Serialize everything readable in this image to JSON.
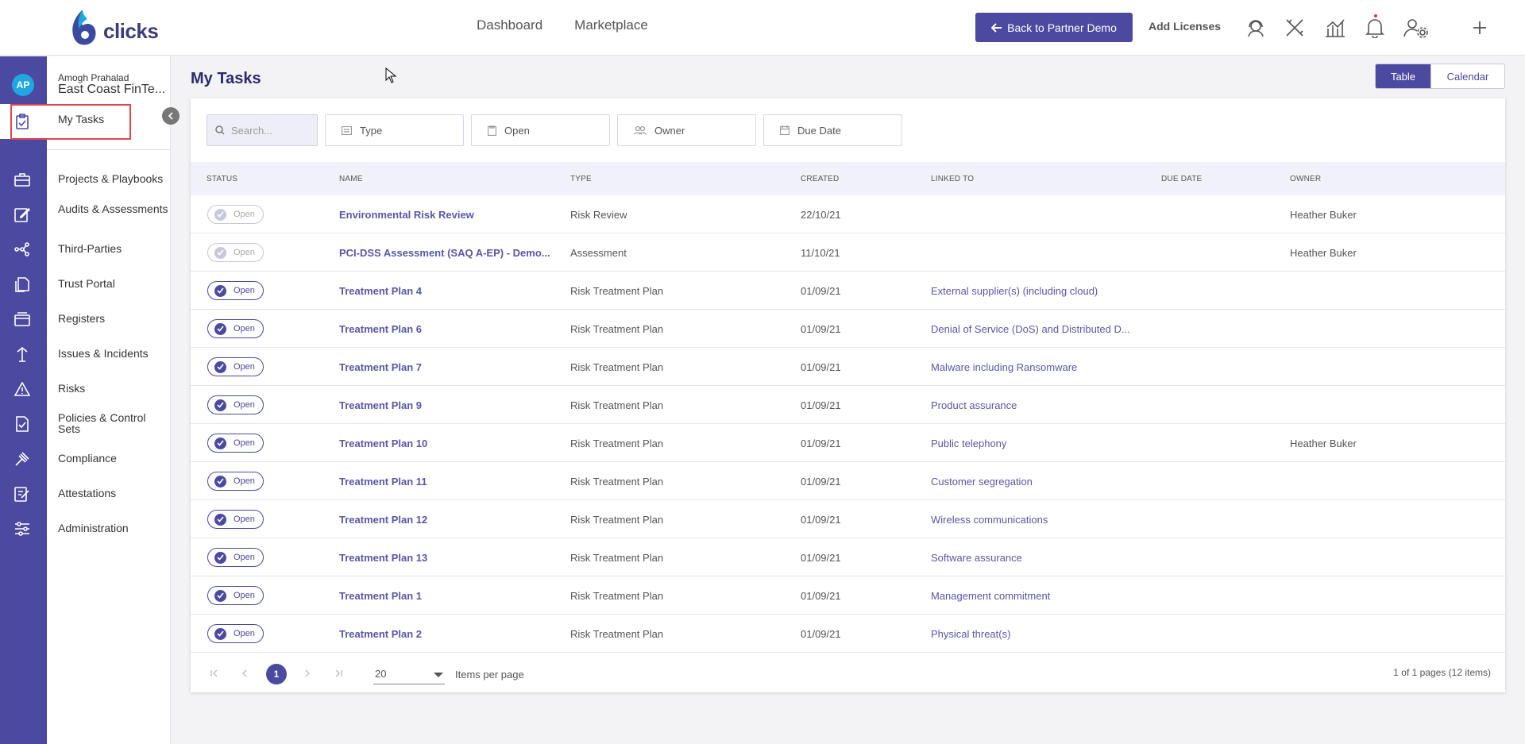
{
  "header": {
    "logo_text": "clicks",
    "nav": [
      "Dashboard",
      "Marketplace"
    ],
    "back_button": "Back to Partner Demo",
    "add_licenses": "Add Licenses"
  },
  "user": {
    "initials": "AP",
    "name": "Amogh Prahalad",
    "org": "East Coast FinTe..."
  },
  "sidebar": {
    "active_item": "My Tasks",
    "items": [
      "Projects & Playbooks",
      "Audits & Assessments",
      "Third-Parties",
      "Trust Portal",
      "Registers",
      "Issues & Incidents",
      "Risks",
      "Policies & Control Sets",
      "Compliance",
      "Attestations",
      "Administration"
    ]
  },
  "page": {
    "title": "My Tasks",
    "view_table": "Table",
    "view_calendar": "Calendar"
  },
  "filters": {
    "search_placeholder": "Search...",
    "type": "Type",
    "status": "Open",
    "owner": "Owner",
    "due": "Due Date"
  },
  "table": {
    "columns": [
      "STATUS",
      "NAME",
      "TYPE",
      "CREATED",
      "LINKED TO",
      "DUE DATE",
      "OWNER"
    ],
    "rows": [
      {
        "status": "Open",
        "name": "Environmental Risk Review",
        "type": "Risk Review",
        "created": "22/10/21",
        "linked": "",
        "due": "",
        "owner": "Heather Buker"
      },
      {
        "status": "Open",
        "name": "PCI-DSS Assessment (SAQ A-EP) - Demo...",
        "type": "Assessment",
        "created": "11/10/21",
        "linked": "",
        "due": "",
        "owner": "Heather Buker"
      },
      {
        "status": "Open",
        "name": "Treatment Plan 4",
        "type": "Risk Treatment Plan",
        "created": "01/09/21",
        "linked": "External supplier(s) (including cloud)",
        "due": "",
        "owner": ""
      },
      {
        "status": "Open",
        "name": "Treatment Plan 6",
        "type": "Risk Treatment Plan",
        "created": "01/09/21",
        "linked": "Denial of Service (DoS) and Distributed D...",
        "due": "",
        "owner": ""
      },
      {
        "status": "Open",
        "name": "Treatment Plan 7",
        "type": "Risk Treatment Plan",
        "created": "01/09/21",
        "linked": "Malware including Ransomware",
        "due": "",
        "owner": ""
      },
      {
        "status": "Open",
        "name": "Treatment Plan 9",
        "type": "Risk Treatment Plan",
        "created": "01/09/21",
        "linked": "Product assurance",
        "due": "",
        "owner": ""
      },
      {
        "status": "Open",
        "name": "Treatment Plan 10",
        "type": "Risk Treatment Plan",
        "created": "01/09/21",
        "linked": "Public telephony",
        "due": "",
        "owner": "Heather Buker"
      },
      {
        "status": "Open",
        "name": "Treatment Plan 11",
        "type": "Risk Treatment Plan",
        "created": "01/09/21",
        "linked": "Customer segregation",
        "due": "",
        "owner": ""
      },
      {
        "status": "Open",
        "name": "Treatment Plan 12",
        "type": "Risk Treatment Plan",
        "created": "01/09/21",
        "linked": "Wireless communications",
        "due": "",
        "owner": ""
      },
      {
        "status": "Open",
        "name": "Treatment Plan 13",
        "type": "Risk Treatment Plan",
        "created": "01/09/21",
        "linked": "Software assurance",
        "due": "",
        "owner": ""
      },
      {
        "status": "Open",
        "name": "Treatment Plan 1",
        "type": "Risk Treatment Plan",
        "created": "01/09/21",
        "linked": "Management commitment",
        "due": "",
        "owner": ""
      },
      {
        "status": "Open",
        "name": "Treatment Plan 2",
        "type": "Risk Treatment Plan",
        "created": "01/09/21",
        "linked": "Physical threat(s)",
        "due": "",
        "owner": ""
      }
    ]
  },
  "pager": {
    "current_page": "1",
    "page_size": "20",
    "per_page_label": "Items per page",
    "info": "1 of 1 pages (12 items)"
  }
}
